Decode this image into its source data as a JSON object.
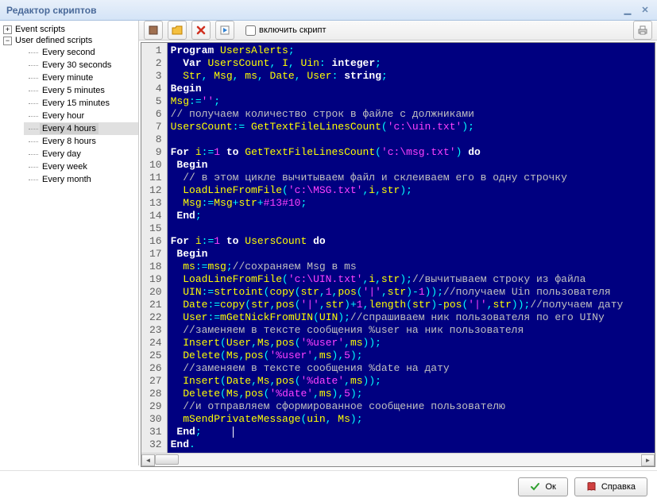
{
  "window": {
    "title": "Редактор скриптов",
    "minimize_icon": "minimize",
    "close_icon": "close"
  },
  "sidebar": {
    "nodes": [
      {
        "label": "Event scripts",
        "expanded": false,
        "children": []
      },
      {
        "label": "User defined scripts",
        "expanded": true,
        "children": [
          {
            "label": "Every second"
          },
          {
            "label": "Every 30 seconds"
          },
          {
            "label": "Every minute"
          },
          {
            "label": "Every 5 minutes"
          },
          {
            "label": "Every 15 minutes"
          },
          {
            "label": "Every hour"
          },
          {
            "label": "Every 4 hours",
            "selected": true
          },
          {
            "label": "Every 8 hours"
          },
          {
            "label": "Every day"
          },
          {
            "label": "Every week"
          },
          {
            "label": "Every month"
          }
        ]
      }
    ]
  },
  "toolbar": {
    "stop_icon": "stop",
    "open_icon": "folder",
    "delete_icon": "delete",
    "run_icon": "run",
    "print_icon": "print",
    "checkbox_label": "включить скрипт",
    "checkbox_checked": false
  },
  "code_lines": [
    [
      [
        "kw",
        "Program"
      ],
      [
        "tx",
        " "
      ],
      [
        "id",
        "UsersAlerts"
      ],
      [
        "op",
        ";"
      ]
    ],
    [
      [
        "tx",
        "  "
      ],
      [
        "kw",
        "Var"
      ],
      [
        "tx",
        " "
      ],
      [
        "id",
        "UsersCount"
      ],
      [
        "op",
        ","
      ],
      [
        "tx",
        " "
      ],
      [
        "id",
        "I"
      ],
      [
        "op",
        ","
      ],
      [
        "tx",
        " "
      ],
      [
        "id",
        "Uin"
      ],
      [
        "op",
        ":"
      ],
      [
        "tx",
        " "
      ],
      [
        "kw",
        "integer"
      ],
      [
        "op",
        ";"
      ]
    ],
    [
      [
        "tx",
        "  "
      ],
      [
        "id",
        "Str"
      ],
      [
        "op",
        ","
      ],
      [
        "tx",
        " "
      ],
      [
        "id",
        "Msg"
      ],
      [
        "op",
        ","
      ],
      [
        "tx",
        " "
      ],
      [
        "id",
        "ms"
      ],
      [
        "op",
        ","
      ],
      [
        "tx",
        " "
      ],
      [
        "id",
        "Date"
      ],
      [
        "op",
        ","
      ],
      [
        "tx",
        " "
      ],
      [
        "id",
        "User"
      ],
      [
        "op",
        ":"
      ],
      [
        "tx",
        " "
      ],
      [
        "kw",
        "string"
      ],
      [
        "op",
        ";"
      ]
    ],
    [
      [
        "kw",
        "Begin"
      ]
    ],
    [
      [
        "id",
        "Msg"
      ],
      [
        "op",
        ":="
      ],
      [
        "str",
        "''"
      ],
      [
        "op",
        ";"
      ]
    ],
    [
      [
        "cm",
        "// получаем количество строк в файле с должниками"
      ]
    ],
    [
      [
        "id",
        "UsersCount"
      ],
      [
        "op",
        ":="
      ],
      [
        "tx",
        " "
      ],
      [
        "fn",
        "GetTextFileLinesCount"
      ],
      [
        "op",
        "("
      ],
      [
        "str",
        "'c:\\uin.txt'"
      ],
      [
        "op",
        ")"
      ],
      [
        "op",
        ";"
      ]
    ],
    [],
    [
      [
        "kw",
        "For"
      ],
      [
        "tx",
        " "
      ],
      [
        "id",
        "i"
      ],
      [
        "op",
        ":="
      ],
      [
        "num",
        "1"
      ],
      [
        "tx",
        " "
      ],
      [
        "kw",
        "to"
      ],
      [
        "tx",
        " "
      ],
      [
        "fn",
        "GetTextFileLinesCount"
      ],
      [
        "op",
        "("
      ],
      [
        "str",
        "'c:\\msg.txt'"
      ],
      [
        "op",
        ")"
      ],
      [
        "tx",
        " "
      ],
      [
        "kw",
        "do"
      ]
    ],
    [
      [
        "tx",
        " "
      ],
      [
        "kw",
        "Begin"
      ]
    ],
    [
      [
        "tx",
        "  "
      ],
      [
        "cm",
        "// в этом цикле вычитываем файл и склеиваем его в одну строчку"
      ]
    ],
    [
      [
        "tx",
        "  "
      ],
      [
        "fn",
        "LoadLineFromFile"
      ],
      [
        "op",
        "("
      ],
      [
        "str",
        "'c:\\MSG.txt'"
      ],
      [
        "op",
        ","
      ],
      [
        "id",
        "i"
      ],
      [
        "op",
        ","
      ],
      [
        "id",
        "str"
      ],
      [
        "op",
        ")"
      ],
      [
        "op",
        ";"
      ]
    ],
    [
      [
        "tx",
        "  "
      ],
      [
        "id",
        "Msg"
      ],
      [
        "op",
        ":="
      ],
      [
        "id",
        "Msg"
      ],
      [
        "op",
        "+"
      ],
      [
        "id",
        "str"
      ],
      [
        "op",
        "+"
      ],
      [
        "num",
        "#13#10"
      ],
      [
        "op",
        ";"
      ]
    ],
    [
      [
        "tx",
        " "
      ],
      [
        "kw",
        "End"
      ],
      [
        "op",
        ";"
      ]
    ],
    [],
    [
      [
        "kw",
        "For"
      ],
      [
        "tx",
        " "
      ],
      [
        "id",
        "i"
      ],
      [
        "op",
        ":="
      ],
      [
        "num",
        "1"
      ],
      [
        "tx",
        " "
      ],
      [
        "kw",
        "to"
      ],
      [
        "tx",
        " "
      ],
      [
        "id",
        "UsersCount"
      ],
      [
        "tx",
        " "
      ],
      [
        "kw",
        "do"
      ]
    ],
    [
      [
        "tx",
        " "
      ],
      [
        "kw",
        "Begin"
      ]
    ],
    [
      [
        "tx",
        "  "
      ],
      [
        "id",
        "ms"
      ],
      [
        "op",
        ":="
      ],
      [
        "id",
        "msg"
      ],
      [
        "op",
        ";"
      ],
      [
        "cm",
        "//сохраняем Msg в ms"
      ]
    ],
    [
      [
        "tx",
        "  "
      ],
      [
        "fn",
        "LoadLineFromFile"
      ],
      [
        "op",
        "("
      ],
      [
        "str",
        "'c:\\UIN.txt'"
      ],
      [
        "op",
        ","
      ],
      [
        "id",
        "i"
      ],
      [
        "op",
        ","
      ],
      [
        "id",
        "str"
      ],
      [
        "op",
        ")"
      ],
      [
        "op",
        ";"
      ],
      [
        "cm",
        "//вычитываем строку из файла"
      ]
    ],
    [
      [
        "tx",
        "  "
      ],
      [
        "id",
        "UIN"
      ],
      [
        "op",
        ":="
      ],
      [
        "fn",
        "strtoint"
      ],
      [
        "op",
        "("
      ],
      [
        "fn",
        "copy"
      ],
      [
        "op",
        "("
      ],
      [
        "id",
        "str"
      ],
      [
        "op",
        ","
      ],
      [
        "num",
        "1"
      ],
      [
        "op",
        ","
      ],
      [
        "fn",
        "pos"
      ],
      [
        "op",
        "("
      ],
      [
        "str",
        "'|'"
      ],
      [
        "op",
        ","
      ],
      [
        "id",
        "str"
      ],
      [
        "op",
        ")"
      ],
      [
        "op",
        "-"
      ],
      [
        "num",
        "1"
      ],
      [
        "op",
        "))"
      ],
      [
        "op",
        ";"
      ],
      [
        "cm",
        "//получаем Uin пользователя"
      ]
    ],
    [
      [
        "tx",
        "  "
      ],
      [
        "id",
        "Date"
      ],
      [
        "op",
        ":="
      ],
      [
        "fn",
        "copy"
      ],
      [
        "op",
        "("
      ],
      [
        "id",
        "str"
      ],
      [
        "op",
        ","
      ],
      [
        "fn",
        "pos"
      ],
      [
        "op",
        "("
      ],
      [
        "str",
        "'|'"
      ],
      [
        "op",
        ","
      ],
      [
        "id",
        "str"
      ],
      [
        "op",
        ")"
      ],
      [
        "op",
        "+"
      ],
      [
        "num",
        "1"
      ],
      [
        "op",
        ","
      ],
      [
        "fn",
        "length"
      ],
      [
        "op",
        "("
      ],
      [
        "id",
        "str"
      ],
      [
        "op",
        ")"
      ],
      [
        "op",
        "-"
      ],
      [
        "fn",
        "pos"
      ],
      [
        "op",
        "("
      ],
      [
        "str",
        "'|'"
      ],
      [
        "op",
        ","
      ],
      [
        "id",
        "str"
      ],
      [
        "op",
        "))"
      ],
      [
        "op",
        ";"
      ],
      [
        "cm",
        "//получаем дату"
      ]
    ],
    [
      [
        "tx",
        "  "
      ],
      [
        "id",
        "User"
      ],
      [
        "op",
        ":="
      ],
      [
        "fn",
        "mGetNickFromUIN"
      ],
      [
        "op",
        "("
      ],
      [
        "id",
        "UIN"
      ],
      [
        "op",
        ")"
      ],
      [
        "op",
        ";"
      ],
      [
        "cm",
        "//спрашиваем ник пользователя по его UINу"
      ]
    ],
    [
      [
        "tx",
        "  "
      ],
      [
        "cm",
        "//заменяем в тексте сообщения %user на ник пользователя"
      ]
    ],
    [
      [
        "tx",
        "  "
      ],
      [
        "fn",
        "Insert"
      ],
      [
        "op",
        "("
      ],
      [
        "id",
        "User"
      ],
      [
        "op",
        ","
      ],
      [
        "id",
        "Ms"
      ],
      [
        "op",
        ","
      ],
      [
        "fn",
        "pos"
      ],
      [
        "op",
        "("
      ],
      [
        "str",
        "'%user'"
      ],
      [
        "op",
        ","
      ],
      [
        "id",
        "ms"
      ],
      [
        "op",
        "))"
      ],
      [
        "op",
        ";"
      ]
    ],
    [
      [
        "tx",
        "  "
      ],
      [
        "fn",
        "Delete"
      ],
      [
        "op",
        "("
      ],
      [
        "id",
        "Ms"
      ],
      [
        "op",
        ","
      ],
      [
        "fn",
        "pos"
      ],
      [
        "op",
        "("
      ],
      [
        "str",
        "'%user'"
      ],
      [
        "op",
        ","
      ],
      [
        "id",
        "ms"
      ],
      [
        "op",
        ")"
      ],
      [
        "op",
        ","
      ],
      [
        "num",
        "5"
      ],
      [
        "op",
        ")"
      ],
      [
        "op",
        ";"
      ]
    ],
    [
      [
        "tx",
        "  "
      ],
      [
        "cm",
        "//заменяем в тексте сообщения %date на дату"
      ]
    ],
    [
      [
        "tx",
        "  "
      ],
      [
        "fn",
        "Insert"
      ],
      [
        "op",
        "("
      ],
      [
        "id",
        "Date"
      ],
      [
        "op",
        ","
      ],
      [
        "id",
        "Ms"
      ],
      [
        "op",
        ","
      ],
      [
        "fn",
        "pos"
      ],
      [
        "op",
        "("
      ],
      [
        "str",
        "'%date'"
      ],
      [
        "op",
        ","
      ],
      [
        "id",
        "ms"
      ],
      [
        "op",
        "))"
      ],
      [
        "op",
        ";"
      ]
    ],
    [
      [
        "tx",
        "  "
      ],
      [
        "fn",
        "Delete"
      ],
      [
        "op",
        "("
      ],
      [
        "id",
        "Ms"
      ],
      [
        "op",
        ","
      ],
      [
        "fn",
        "pos"
      ],
      [
        "op",
        "("
      ],
      [
        "str",
        "'%date'"
      ],
      [
        "op",
        ","
      ],
      [
        "id",
        "ms"
      ],
      [
        "op",
        ")"
      ],
      [
        "op",
        ","
      ],
      [
        "num",
        "5"
      ],
      [
        "op",
        ")"
      ],
      [
        "op",
        ";"
      ]
    ],
    [
      [
        "tx",
        "  "
      ],
      [
        "cm",
        "//и отправляем сформированное сообщение пользователю"
      ]
    ],
    [
      [
        "tx",
        "  "
      ],
      [
        "fn",
        "mSendPrivateMessage"
      ],
      [
        "op",
        "("
      ],
      [
        "id",
        "uin"
      ],
      [
        "op",
        ","
      ],
      [
        "tx",
        " "
      ],
      [
        "id",
        "Ms"
      ],
      [
        "op",
        ")"
      ],
      [
        "op",
        ";"
      ]
    ],
    [
      [
        "tx",
        " "
      ],
      [
        "kw",
        "End"
      ],
      [
        "op",
        ";"
      ],
      [
        "tx",
        "     "
      ],
      [
        "caret",
        ""
      ]
    ],
    [
      [
        "kw",
        "End"
      ],
      [
        "op",
        "."
      ]
    ]
  ],
  "footer": {
    "ok_label": "Ок",
    "help_label": "Справка"
  }
}
